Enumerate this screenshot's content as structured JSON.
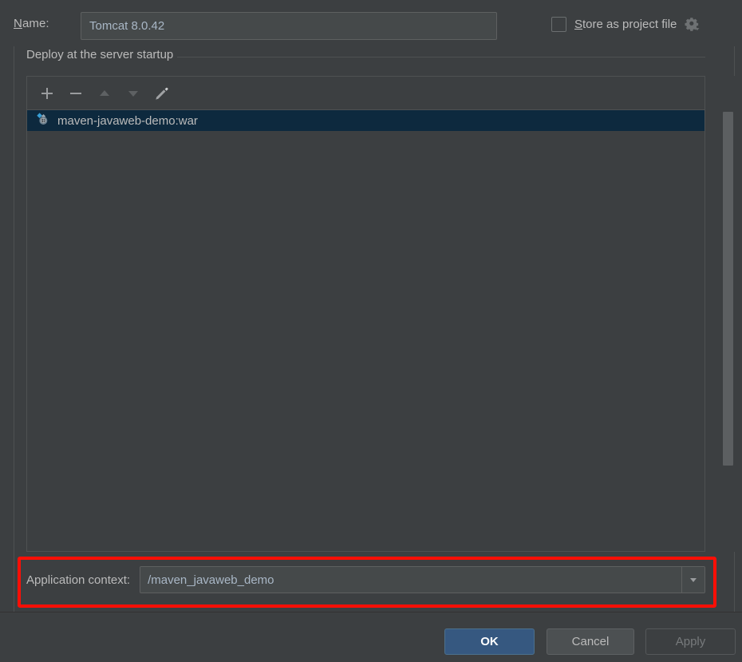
{
  "dialog": {
    "name_label": "Name:",
    "name_label_mnemonic": "N",
    "name_label_rest": "ame:",
    "name_value": "Tomcat 8.0.42",
    "store_as_project_file_mnemonic": "S",
    "store_as_project_file_rest": "tore as project file",
    "store_as_project_file_checked": false,
    "gear_icon": "gear-icon"
  },
  "group": {
    "title": "Deploy at the server startup"
  },
  "toolbar": {
    "buttons": [
      {
        "name": "add-button",
        "icon": "plus-icon",
        "enabled": true
      },
      {
        "name": "remove-button",
        "icon": "minus-icon",
        "enabled": true
      },
      {
        "name": "move-up-button",
        "icon": "arrow-up-icon",
        "enabled": false
      },
      {
        "name": "move-down-button",
        "icon": "arrow-down-icon",
        "enabled": false
      },
      {
        "name": "edit-button",
        "icon": "pencil-icon",
        "enabled": true
      }
    ]
  },
  "deploy_list": {
    "items": [
      {
        "label": "maven-javaweb-demo:war",
        "icon": "maven-war-artifact-icon",
        "selected": true
      }
    ]
  },
  "application_context": {
    "label": "Application context:",
    "value": "/maven_javaweb_demo",
    "placeholder": "",
    "dropdown_icon": "chevron-down-icon"
  },
  "buttons": {
    "ok": "OK",
    "cancel": "Cancel",
    "apply": "Apply",
    "apply_enabled": false
  },
  "colors": {
    "background": "#3c3f41",
    "field_background": "#45494a",
    "selection": "#0d293e",
    "accent_button": "#365880",
    "text": "#bbbbbb",
    "field_text": "#a9b7c6",
    "annotation": "#ff0f06",
    "scrollbar_thumb": "#5c5f61"
  }
}
